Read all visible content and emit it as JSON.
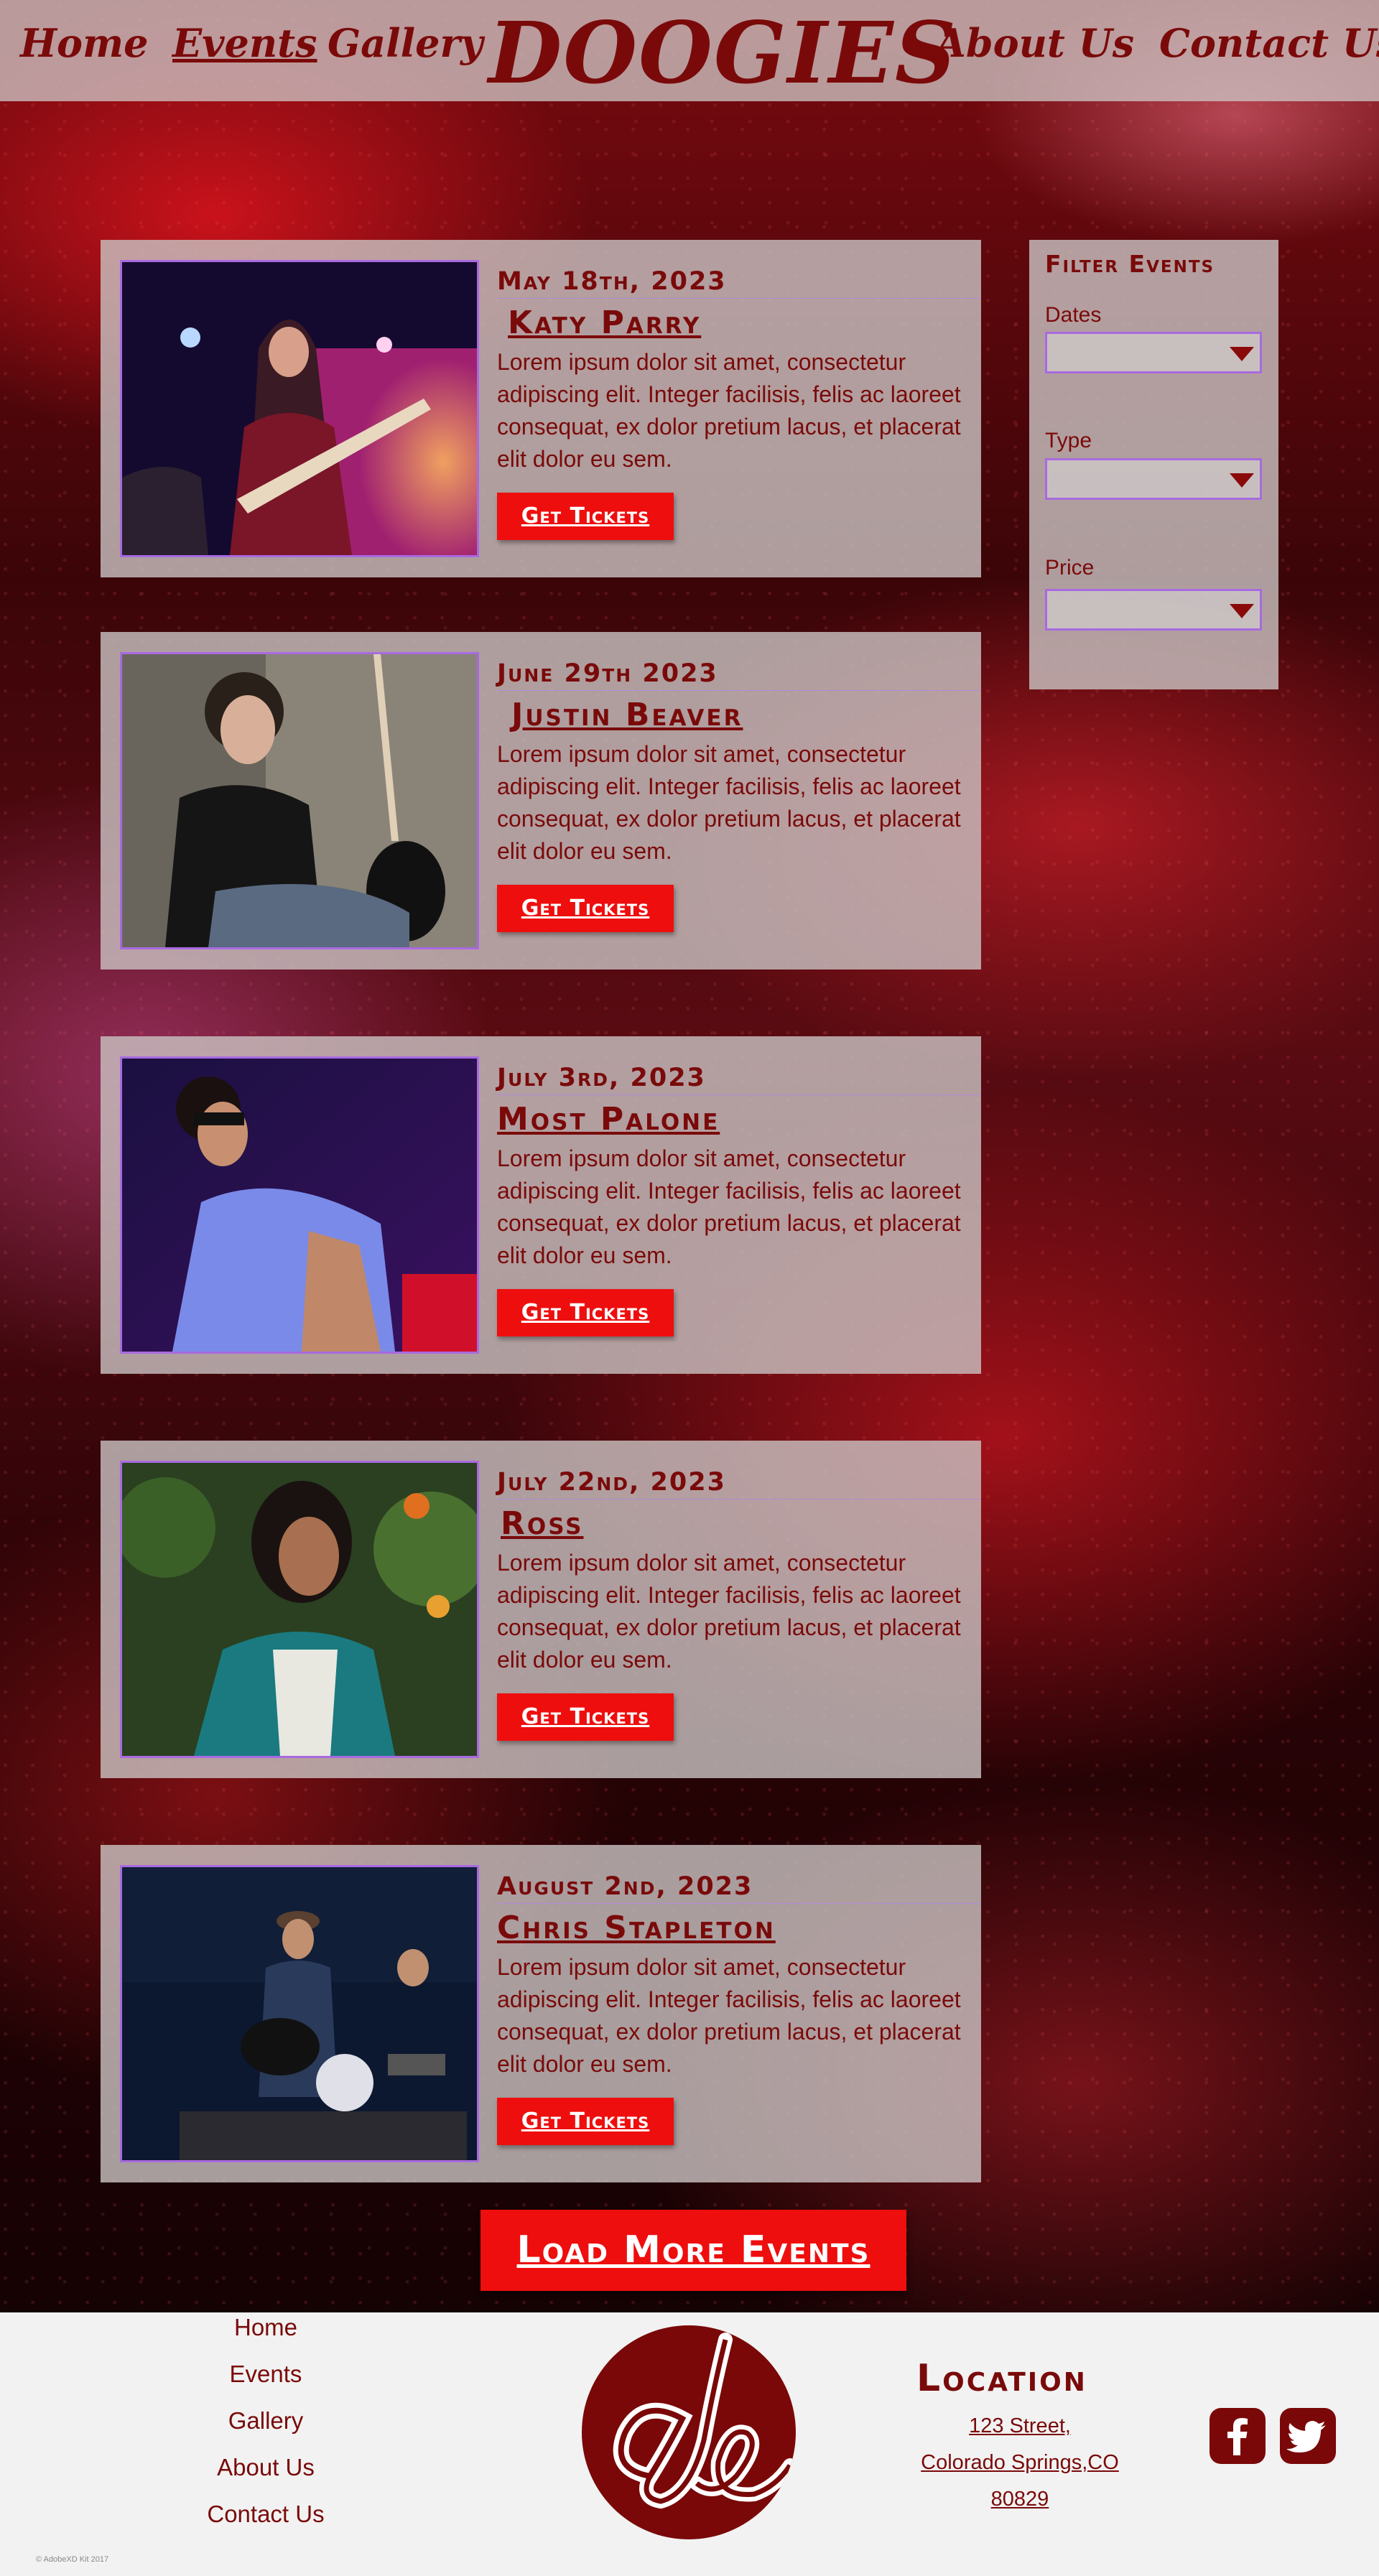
{
  "nav": {
    "home": "Home",
    "events": "Events",
    "gallery": "Gallery",
    "brand": "DOOGIES",
    "about": "About Us",
    "contact": "Contact Us"
  },
  "events": [
    {
      "date": "May 18th, 2023",
      "name": "Katy Parry",
      "description": "Lorem ipsum dolor sit amet, consectetur adipiscing elit. Integer facilisis, felis ac laoreet consequat, ex dolor pretium lacus, et placerat elit dolor eu sem.",
      "button": "Get Tickets"
    },
    {
      "date": "June 29th 2023",
      "name": "Justin Beaver",
      "description": "Lorem ipsum dolor sit amet, consectetur adipiscing elit. Integer facilisis, felis ac laoreet consequat, ex dolor pretium lacus, et placerat elit dolor eu sem.",
      "button": "Get Tickets"
    },
    {
      "date": "July 3rd, 2023",
      "name": "Most Palone",
      "description": "Lorem ipsum dolor sit amet, consectetur adipiscing elit. Integer facilisis, felis ac laoreet consequat, ex dolor pretium lacus, et placerat elit dolor eu sem.",
      "button": "Get Tickets"
    },
    {
      "date": "July 22nd, 2023",
      "name": "Ross",
      "description": "Lorem ipsum dolor sit amet, consectetur adipiscing elit. Integer facilisis, felis ac laoreet consequat, ex dolor pretium lacus, et placerat elit dolor eu sem.",
      "button": "Get Tickets"
    },
    {
      "date": "August 2nd, 2023",
      "name": "Chris Stapleton",
      "description": "Lorem ipsum dolor sit amet, consectetur adipiscing elit. Integer facilisis, felis ac laoreet consequat, ex dolor pretium lacus, et placerat elit dolor eu sem.",
      "button": "Get Tickets"
    }
  ],
  "filter": {
    "title": "Filter Events",
    "dates_label": "Dates",
    "type_label": "Type",
    "price_label": "Price"
  },
  "load_more": "Load More Events",
  "footer": {
    "links": [
      "Home",
      "Events",
      "Gallery",
      "About Us",
      "Contact Us"
    ],
    "location_title": "Location",
    "address": [
      "123 Street,",
      "Colorado Springs,CO",
      "80829"
    ],
    "copyright": "© AdobeXD Kit 2017",
    "social": [
      "facebook-icon",
      "twitter-icon"
    ]
  },
  "colors": {
    "brand": "#7a0a0a",
    "accent": "#ee0e0e",
    "border": "#a86ae0"
  }
}
